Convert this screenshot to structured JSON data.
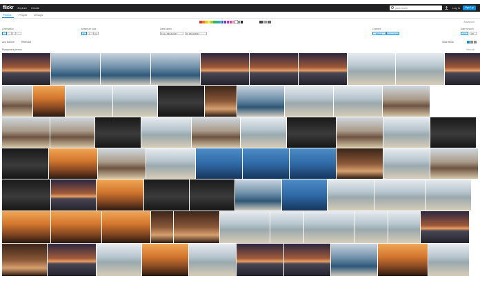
{
  "header": {
    "logo": "flickr",
    "nav": [
      "Explore",
      "Create"
    ],
    "search_placeholder": "gaza beach",
    "login": "Log In",
    "signup": "Sign Up"
  },
  "tabs": [
    {
      "label": "Photos",
      "active": true
    },
    {
      "label": "People",
      "active": false
    },
    {
      "label": "Groups",
      "active": false
    }
  ],
  "advanced_label": "Advanced",
  "color_swatches": [
    "#e23a2a",
    "#f07a22",
    "#f5c51b",
    "#f4e84b",
    "#9bd23c",
    "#38b24a",
    "#27b29a",
    "#27a8d8",
    "#2a64d2",
    "#6a3cc8",
    "#b03cc8",
    "#e23a9a",
    "#f08aa8",
    "#ffffff",
    "#888888",
    "#222222"
  ],
  "filters": {
    "orientation_label": "Orientation",
    "min_size_label": "Minimum size",
    "min_size_options": [
      "M",
      "L",
      "XL"
    ],
    "date_taken_label": "Date taken",
    "date_from_prefix": "From",
    "date_from": "09/14/2017",
    "date_to_prefix": "To",
    "date_to": "09/14/2017",
    "content_label": "Content",
    "content_options": [
      "Photos",
      "Screenshots"
    ],
    "safe_label": "Safe search",
    "safe_options": [
      "On",
      "Off"
    ]
  },
  "bar": {
    "license": "Any license",
    "sort": "Relevant",
    "right": "Slide show"
  },
  "results_title": "Everyone's photos",
  "results_count": "View all"
}
